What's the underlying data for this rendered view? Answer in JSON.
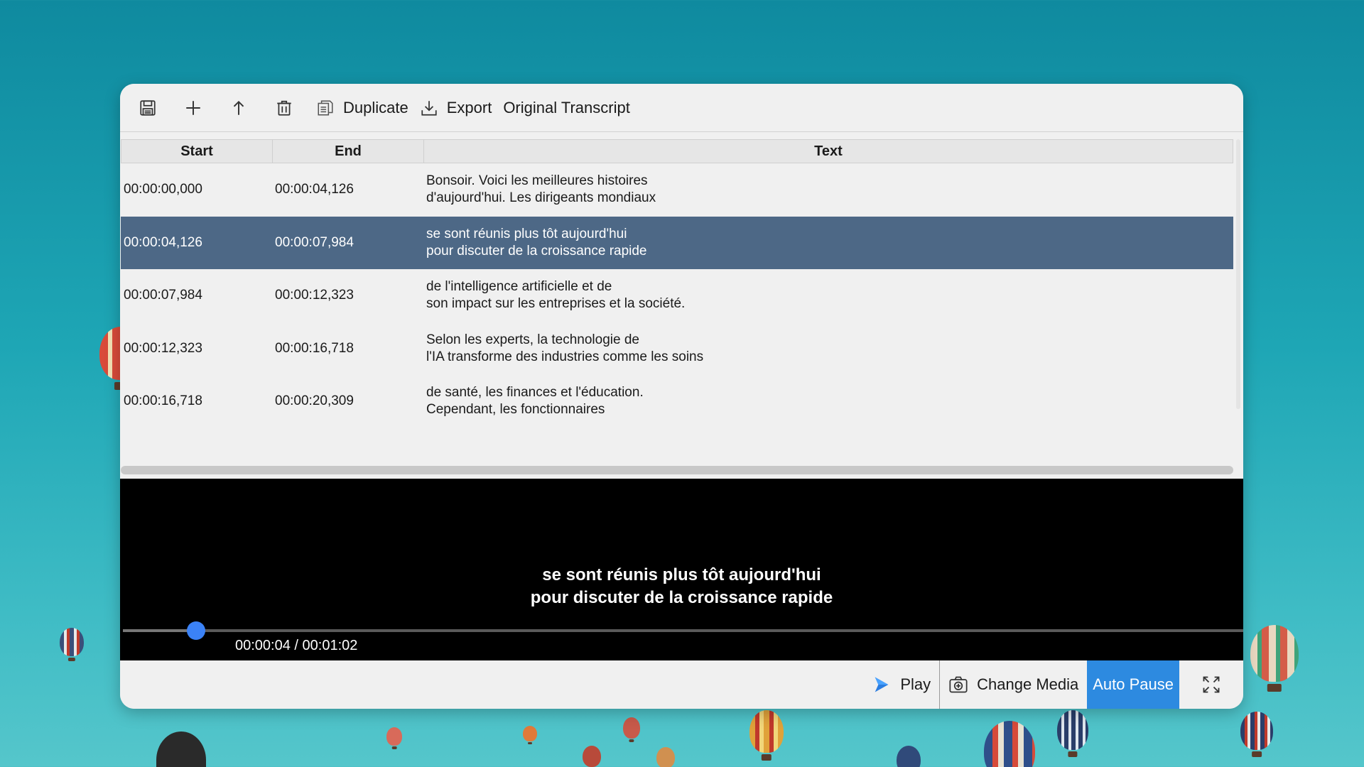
{
  "toolbar": {
    "icons": [
      "save-icon",
      "add-icon",
      "move-up-icon",
      "delete-icon"
    ],
    "duplicate_label": "Duplicate",
    "export_label": "Export",
    "original_transcript_label": "Original Transcript"
  },
  "table": {
    "headers": {
      "start": "Start",
      "end": "End",
      "text": "Text"
    },
    "rows": [
      {
        "start": "00:00:00,000",
        "end": "00:00:04,126",
        "text1": "Bonsoir. Voici les meilleures histoires",
        "text2": "d'aujourd'hui. Les dirigeants mondiaux",
        "selected": false
      },
      {
        "start": "00:00:04,126",
        "end": "00:00:07,984",
        "text1": "se sont réunis plus tôt aujourd'hui",
        "text2": "pour discuter de la croissance rapide",
        "selected": true
      },
      {
        "start": "00:00:07,984",
        "end": "00:00:12,323",
        "text1": "de l'intelligence artificielle et de",
        "text2": "son impact sur les entreprises et la société.",
        "selected": false
      },
      {
        "start": "00:00:12,323",
        "end": "00:00:16,718",
        "text1": "Selon les experts, la technologie de",
        "text2": "l'IA transforme des industries comme les soins",
        "selected": false
      },
      {
        "start": "00:00:16,718",
        "end": "00:00:20,309",
        "text1": "de santé, les finances et l'éducation.",
        "text2": "Cependant, les fonctionnaires",
        "selected": false
      }
    ]
  },
  "video": {
    "subtitle_line1": "se sont réunis plus tôt aujourd'hui",
    "subtitle_line2": "pour discuter de la croissance rapide",
    "time_display": "00:00:04 / 00:01:02",
    "progress_fraction": 0.065
  },
  "controls": {
    "play_label": "Play",
    "change_media_label": "Change Media",
    "auto_pause_label": "Auto Pause"
  },
  "colors": {
    "selected_row": "#4d6886",
    "auto_pause_bg": "#2d8ae0",
    "seek_knob": "#3b82f6"
  }
}
